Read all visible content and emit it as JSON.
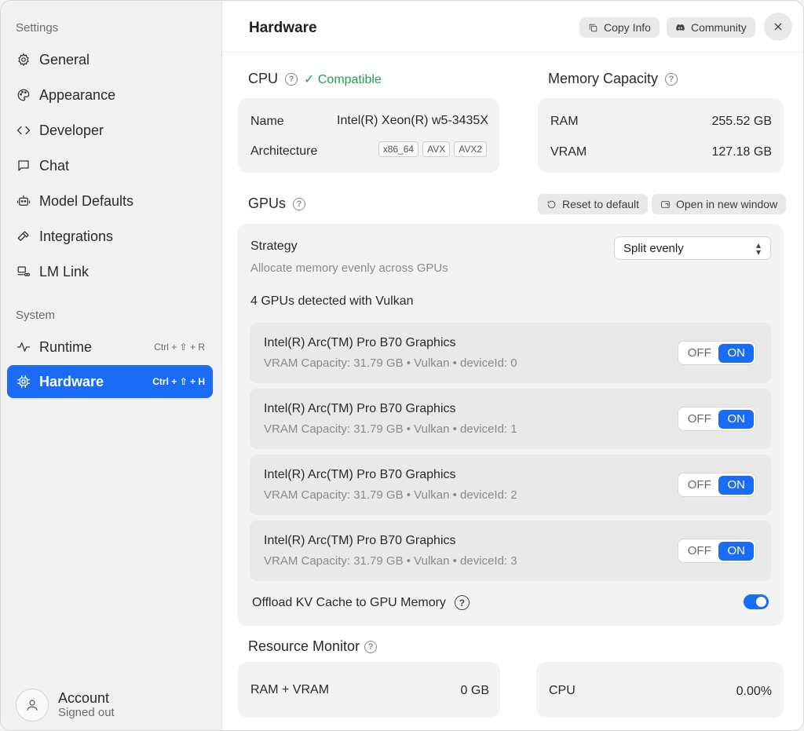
{
  "sidebar": {
    "settings_heading": "Settings",
    "items": [
      {
        "label": "General",
        "icon": "gear-icon"
      },
      {
        "label": "Appearance",
        "icon": "palette-icon"
      },
      {
        "label": "Developer",
        "icon": "code-icon"
      },
      {
        "label": "Chat",
        "icon": "chat-icon"
      },
      {
        "label": "Model Defaults",
        "icon": "robot-icon"
      },
      {
        "label": "Integrations",
        "icon": "hammer-icon"
      },
      {
        "label": "LM Link",
        "icon": "link-icon"
      }
    ],
    "system_heading": "System",
    "system_items": [
      {
        "label": "Runtime",
        "shortcut": "Ctrl + ⇧ + R",
        "icon": "pulse-icon"
      },
      {
        "label": "Hardware",
        "shortcut": "Ctrl + ⇧ + H",
        "icon": "chip-icon",
        "active": true
      }
    ],
    "account": {
      "name": "Account",
      "status": "Signed out"
    }
  },
  "header": {
    "title": "Hardware",
    "copy_info": "Copy Info",
    "community": "Community"
  },
  "cpu": {
    "title": "CPU",
    "status": "✓ Compatible",
    "name_label": "Name",
    "name_value": "Intel(R) Xeon(R) w5-3435X",
    "arch_label": "Architecture",
    "arch_tags": [
      "x86_64",
      "AVX",
      "AVX2"
    ]
  },
  "memory": {
    "title": "Memory Capacity",
    "ram_label": "RAM",
    "ram_value": "255.52 GB",
    "vram_label": "VRAM",
    "vram_value": "127.18 GB"
  },
  "gpus": {
    "title": "GPUs",
    "reset_label": "Reset to default",
    "open_window_label": "Open in new window",
    "strategy_label": "Strategy",
    "strategy_desc": "Allocate memory evenly across GPUs",
    "strategy_value": "Split evenly",
    "detected_text": "4 GPUs detected with Vulkan",
    "off_label": "OFF",
    "on_label": "ON",
    "devices": [
      {
        "name": "Intel(R) Arc(TM) Pro B70 Graphics",
        "meta": "VRAM Capacity: 31.79 GB • Vulkan • deviceId: 0"
      },
      {
        "name": "Intel(R) Arc(TM) Pro B70 Graphics",
        "meta": "VRAM Capacity: 31.79 GB • Vulkan • deviceId: 1"
      },
      {
        "name": "Intel(R) Arc(TM) Pro B70 Graphics",
        "meta": "VRAM Capacity: 31.79 GB • Vulkan • deviceId: 2"
      },
      {
        "name": "Intel(R) Arc(TM) Pro B70 Graphics",
        "meta": "VRAM Capacity: 31.79 GB • Vulkan • deviceId: 3"
      }
    ],
    "offload_label": "Offload KV Cache to GPU Memory",
    "offload_enabled": true
  },
  "resource_monitor": {
    "title": "Resource Monitor",
    "ram_vram_label": "RAM + VRAM",
    "ram_vram_value": "0 GB",
    "cpu_label": "CPU",
    "cpu_value": "0.00%"
  },
  "colors": {
    "accent": "#1a6bf5",
    "compatible": "#1aa34a",
    "sidebar_bg": "#f1f1f1",
    "card_bg": "#f3f3f3"
  }
}
